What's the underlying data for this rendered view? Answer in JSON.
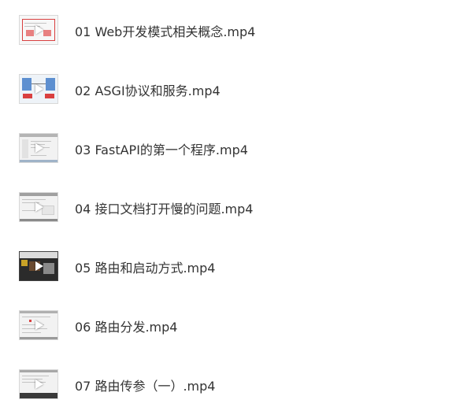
{
  "files": [
    {
      "name": "01 Web开发模式相关概念.mp4",
      "thumb_icon": "video-thumbnail-icon",
      "thumb_style": "red-frame"
    },
    {
      "name": "02 ASGI协议和服务.mp4",
      "thumb_icon": "video-thumbnail-icon",
      "thumb_style": "diagram"
    },
    {
      "name": "03 FastAPI的第一个程序.mp4",
      "thumb_icon": "video-thumbnail-icon",
      "thumb_style": "code-light"
    },
    {
      "name": "04 接口文档打开慢的问题.mp4",
      "thumb_icon": "video-thumbnail-icon",
      "thumb_style": "code-light"
    },
    {
      "name": "05 路由和启动方式.mp4",
      "thumb_icon": "video-thumbnail-icon",
      "thumb_style": "dark"
    },
    {
      "name": "06 路由分发.mp4",
      "thumb_icon": "video-thumbnail-icon",
      "thumb_style": "code-light"
    },
    {
      "name": "07 路由传参（一）.mp4",
      "thumb_icon": "video-thumbnail-icon",
      "thumb_style": "code-dark-bottom"
    }
  ],
  "colors": {
    "text": "#333333",
    "background": "#ffffff",
    "thumb_bg": "#f2f2f2"
  }
}
